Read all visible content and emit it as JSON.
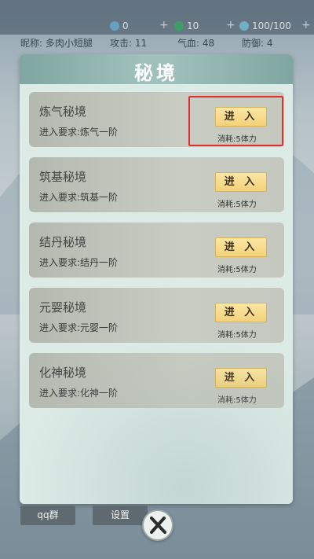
{
  "topbar": {
    "resources": [
      {
        "icon": "spirit-stone-icon",
        "value": "0",
        "color": "#6fb0d6"
      },
      {
        "icon": "jade-icon",
        "value": "10",
        "color": "#3fae6b"
      },
      {
        "icon": "energy-icon",
        "value": "100/100",
        "color": "#7ac1d9"
      }
    ],
    "plus_symbol": "+"
  },
  "stats": {
    "nickname": "昵称: 多肉小短腿",
    "attack": "攻击: 11",
    "hp": "气血: 48",
    "defense": "防御: 4"
  },
  "modal": {
    "title": "秘境",
    "realms": [
      {
        "name": "炼气秘境",
        "requirement": "进入要求:炼气一阶",
        "button": "进 入",
        "cost": "消耗:5体力"
      },
      {
        "name": "筑基秘境",
        "requirement": "进入要求:筑基一阶",
        "button": "进 入",
        "cost": "消耗:5体力"
      },
      {
        "name": "结丹秘境",
        "requirement": "进入要求:结丹一阶",
        "button": "进 入",
        "cost": "消耗:5体力"
      },
      {
        "name": "元婴秘境",
        "requirement": "进入要求:元婴一阶",
        "button": "进 入",
        "cost": "消耗:5体力"
      },
      {
        "name": "化神秘境",
        "requirement": "进入要求:化神一阶",
        "button": "进 入",
        "cost": "消耗:5体力"
      }
    ]
  },
  "bottom": {
    "qq_group": "qq群",
    "settings": "设置",
    "close_icon": "close-x-icon"
  },
  "colors": {
    "accent_header": "#9fc0bb",
    "button_gold": "#f3d27a",
    "highlight_red": "#e0302e"
  }
}
